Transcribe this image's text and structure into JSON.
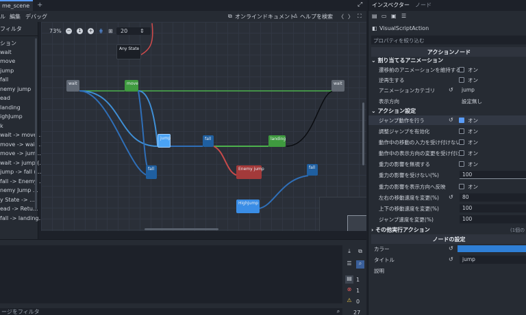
{
  "editor": {
    "tab_label": "me_scene",
    "tab_plus": "+",
    "menu": [
      "ル",
      "編集",
      "デバッグ"
    ],
    "online_docs": "オンラインドキュメント",
    "help_search": "ヘルプを検索",
    "nav_back": "〈",
    "nav_forward": "〉"
  },
  "left_panel": {
    "filter_label": "フィルタ",
    "items": [
      "ション",
      "wait",
      "move",
      "jump",
      "fall",
      "nemy jump",
      "ead",
      "landing",
      "ighJump",
      "k",
      "wait -> move ...",
      "move -> wait ...",
      "move -> jum...",
      "wait -> jump (...",
      "jump -> fall (...",
      "fall -> Enemy ...",
      "nemy Jump ...",
      "y State -> ...",
      "ead -> Retu...",
      "fall -> landing..."
    ]
  },
  "graph": {
    "zoom": "73%",
    "snap": "20",
    "nodes": {
      "any_state": "Any State",
      "wait": "wait",
      "move": "move",
      "jump": "jump",
      "fall": "fall",
      "landing": "landing",
      "fall2": "fall",
      "enemy_jump": "Enemy jump",
      "fall3": "fall",
      "high_jump": "HighJump",
      "wait2": "wait"
    }
  },
  "bottom": {
    "filter_placeholder": "ージをフィルタ",
    "counts": [
      "1",
      "1",
      "0"
    ],
    "line_count": "27"
  },
  "inspector": {
    "tab_inspector": "インスペクター",
    "tab_node": "ノード",
    "object_name": "VisualScriptAction",
    "filter_placeholder": "プロパティを絞り込む",
    "section_title": "アクションノード",
    "group_anim": "割り当てるアニメーション",
    "rows_anim": [
      {
        "label": "遷移前のアニメーションを維持する",
        "value": "オン",
        "checked": false
      },
      {
        "label": "逆再生する",
        "value": "オン",
        "checked": false
      }
    ],
    "anim_category_label": "アニメーションカテゴリ",
    "anim_category_value": "jump",
    "display_dir_label": "表示方向",
    "display_dir_value": "設定無し",
    "group_action": "アクション設定",
    "rows_action": [
      {
        "label": "ジャンプ動作を行う",
        "value": "オン",
        "checked": true
      },
      {
        "label": "調整ジャンプを有効化",
        "value": "オン",
        "checked": false
      },
      {
        "label": "動作中の移動の入力を受け付けない",
        "value": "オン",
        "checked": false
      },
      {
        "label": "動作中の表示方向の変更を受け付け",
        "value": "オン",
        "checked": false
      },
      {
        "label": "重力の影響を無視する",
        "value": "オン",
        "checked": false
      }
    ],
    "gravity_ratio_label": "重力の影響を受けない(%)",
    "gravity_ratio_value": "100",
    "gravity_reverse_label": "重力の影響を表示方向へ反映",
    "gravity_reverse_value": "オン",
    "lr_speed_label": "左右の移動速度を変更(%)",
    "lr_speed_value": "80",
    "ud_speed_label": "上下の移動速度を変更(%)",
    "ud_speed_value": "100",
    "jump_speed_label": "ジャンプ速度を変更(%)",
    "jump_speed_value": "100",
    "group_other": "その他実行アクション",
    "group_other_value": "(1個の",
    "node_settings": "ノードの設定",
    "color_label": "カラー",
    "color_value": "#2f7fd6",
    "title_label": "タイトル",
    "title_value": "jump",
    "desc_label": "説明"
  }
}
